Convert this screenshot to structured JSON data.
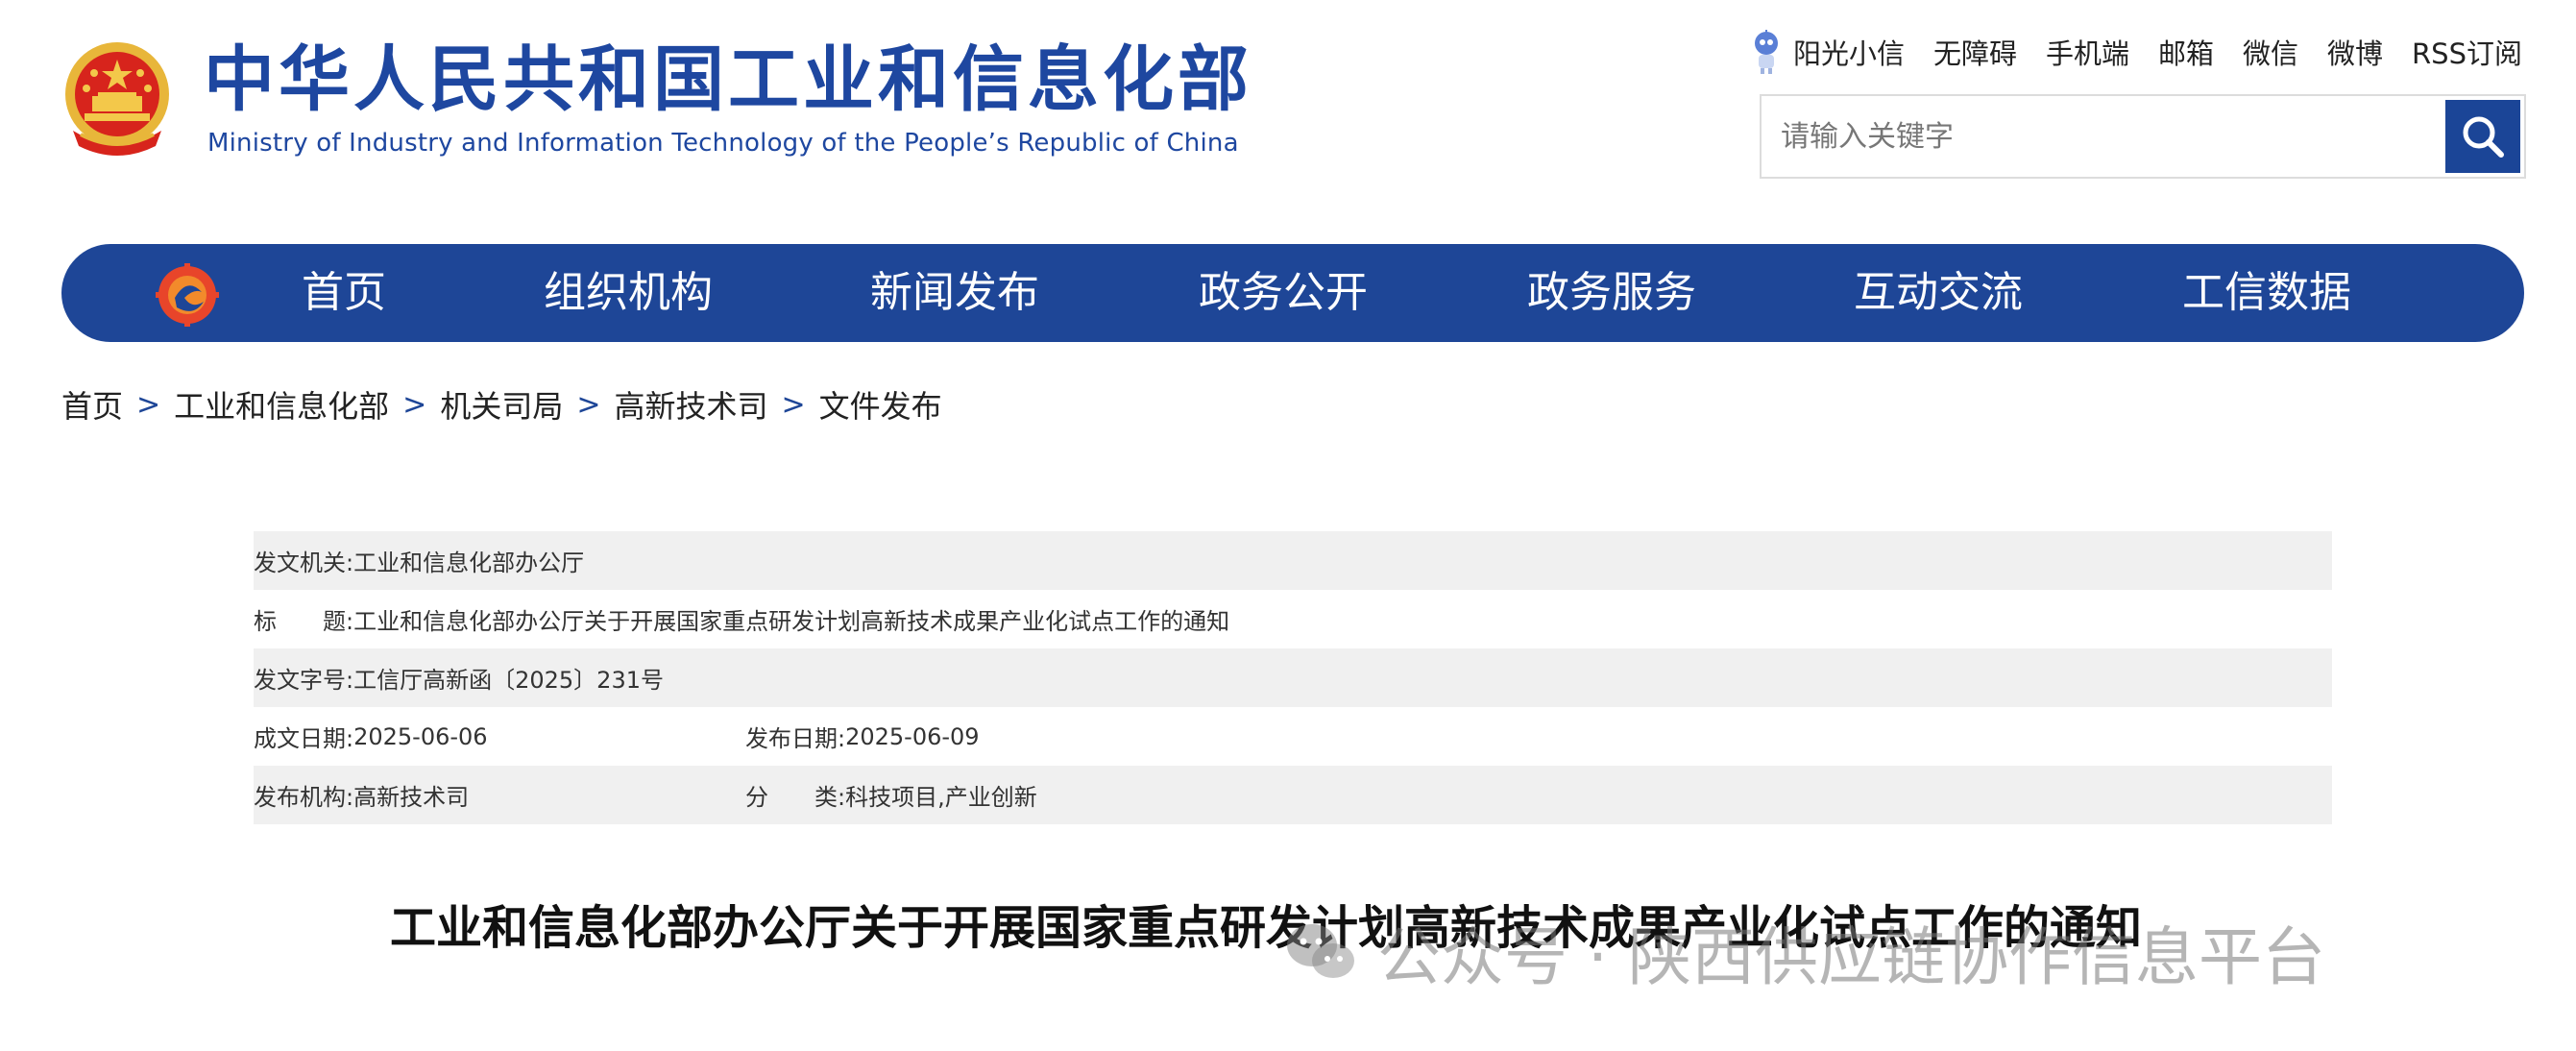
{
  "site": {
    "name_cn": "中华人民共和国工业和信息化部",
    "name_en": "Ministry of Industry and Information Technology of the People’s Republic of China"
  },
  "toplinks": [
    "阳光小信",
    "无障碍",
    "手机端",
    "邮箱",
    "微信",
    "微博",
    "RSS订阅"
  ],
  "search": {
    "placeholder": "请输入关键字"
  },
  "nav": [
    "首页",
    "组织机构",
    "新闻发布",
    "政务公开",
    "政务服务",
    "互动交流",
    "工信数据"
  ],
  "breadcrumb": [
    "首页",
    "工业和信息化部",
    "机关司局",
    "高新技术司",
    "文件发布"
  ],
  "breadcrumb_sep": ">",
  "info": {
    "issuer_label": "发文机关:",
    "issuer": "工业和信息化部办公厅",
    "title_label": "标　　题:",
    "title": "工业和信息化部办公厅关于开展国家重点研发计划高新技术成果产业化试点工作的通知",
    "docno_label": "发文字号:",
    "docno": "工信厅高新函〔2025〕231号",
    "written_label": "成文日期:",
    "written": "2025-06-06",
    "published_label": "发布日期:",
    "published": "2025-06-09",
    "org_label": "发布机构:",
    "org": "高新技术司",
    "category_label": "分　　类:",
    "category": "科技项目,产业创新"
  },
  "doc_title": "工业和信息化部办公厅关于开展国家重点研发计划高新技术成果产业化试点工作的通知",
  "watermark": "公众号 · 陕西供应链协作信息平台",
  "colors": {
    "brand_blue": "#1e4697",
    "row_shade": "#f0f0f0",
    "emblem_red": "#d7241c",
    "emblem_gold": "#e8b63a"
  }
}
